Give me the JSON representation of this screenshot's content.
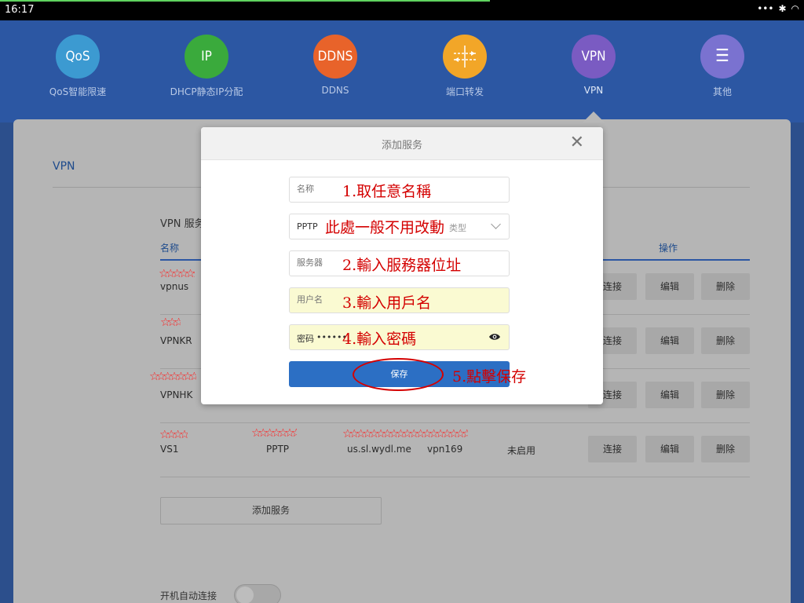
{
  "status": {
    "time": "16:17"
  },
  "nav": [
    {
      "icon": "qos-icon",
      "label": "QoS智能限速",
      "glyph": "QoS",
      "color": "#3c9ad1"
    },
    {
      "icon": "ip-icon",
      "label": "DHCP静态IP分配",
      "glyph": "IP",
      "color": "#3aaa3c"
    },
    {
      "icon": "ddns-icon",
      "label": "DDNS",
      "glyph": "DDNS",
      "color": "#e8632a"
    },
    {
      "icon": "port-forward-icon",
      "label": "端口转发",
      "glyph": "",
      "color": "#f2a628"
    },
    {
      "icon": "vpn-icon",
      "label": "VPN",
      "glyph": "VPN",
      "color": "#7a5bc2"
    },
    {
      "icon": "menu-icon",
      "label": "其他",
      "glyph": "☰",
      "color": "#7a72d0"
    }
  ],
  "page": {
    "section_title": "VPN",
    "sub_title": "VPN 服务",
    "col_name": "名称",
    "col_op": "操作",
    "rows": [
      {
        "name": "vpnus",
        "type": "",
        "server": "",
        "status": ""
      },
      {
        "name": "VPNKR",
        "type": "",
        "server": "",
        "status": ""
      },
      {
        "name": "VPNHK",
        "type": "",
        "server": "",
        "status": ""
      },
      {
        "name": "VS1",
        "type": "PPTP",
        "server": "us.sl.wydl.me",
        "user": "vpn169",
        "status": "未启用"
      }
    ],
    "connect_label": "连接",
    "edit_label": "编辑",
    "delete_label": "删除",
    "add_service": "添加服务",
    "auto_connect": "开机自动连接"
  },
  "modal": {
    "title": "添加服务",
    "name_placeholder": "名称",
    "type_value": "PPTP",
    "type_ghost": "类型",
    "server_placeholder": "服务器",
    "user_placeholder": "用户名",
    "password_placeholder": "密码",
    "password_dots": "••••••",
    "save": "保存"
  },
  "annotations": {
    "a1": "1.取任意名稱",
    "a0": "此處一般不用改動",
    "a2": "2.輸入服務器位址",
    "a3": "3.輸入用戶名",
    "a4": "4.輸入密碼",
    "a5": "5.點擊保存"
  }
}
